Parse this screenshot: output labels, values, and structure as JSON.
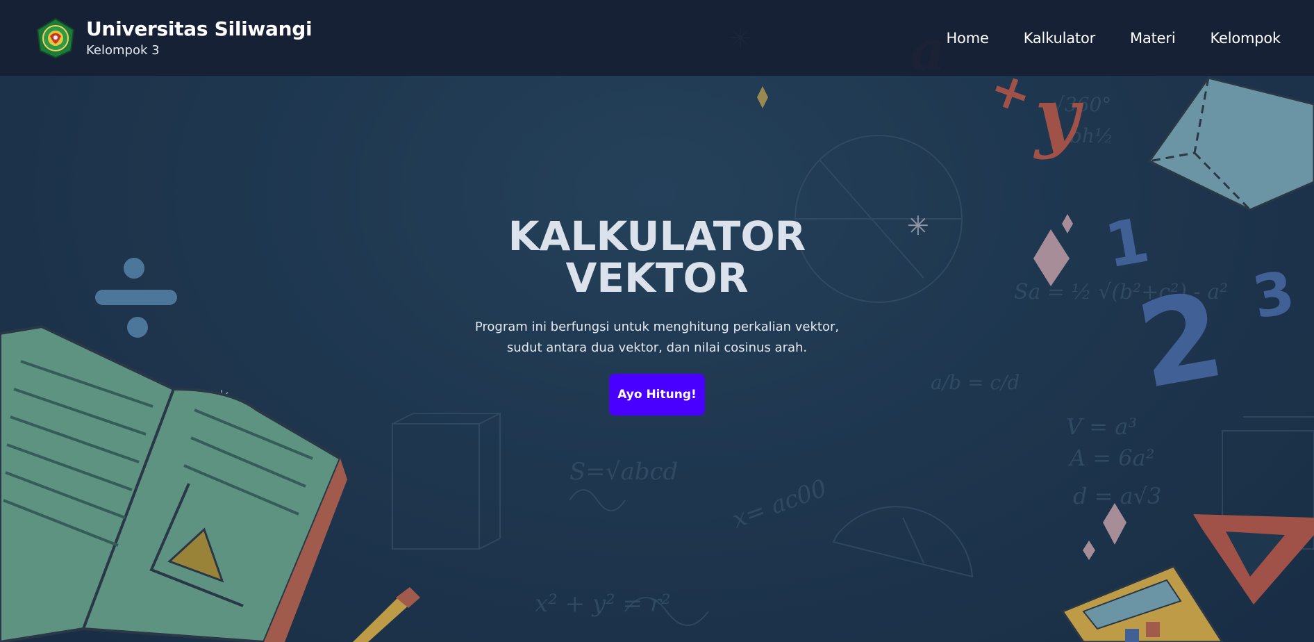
{
  "header": {
    "logo_icon": "universitas-siliwangi-seal-icon",
    "title": "Universitas Siliwangi",
    "subtitle": "Kelompok 3"
  },
  "nav": {
    "items": [
      {
        "label": "Home"
      },
      {
        "label": "Kalkulator"
      },
      {
        "label": "Materi"
      },
      {
        "label": "Kelompok"
      }
    ]
  },
  "hero": {
    "title_line1": "KALKULATOR",
    "title_line2": "VEKTOR",
    "description_line1": "Program ini berfungsi untuk menghitung perkalian vektor,",
    "description_line2": "sudut antara dua vektor, dan nilai cosinus arah.",
    "button_label": "Ayo Hitung!"
  },
  "colors": {
    "navbar": "#162034",
    "accent_button": "#4a00ff",
    "background": "#223d57"
  }
}
